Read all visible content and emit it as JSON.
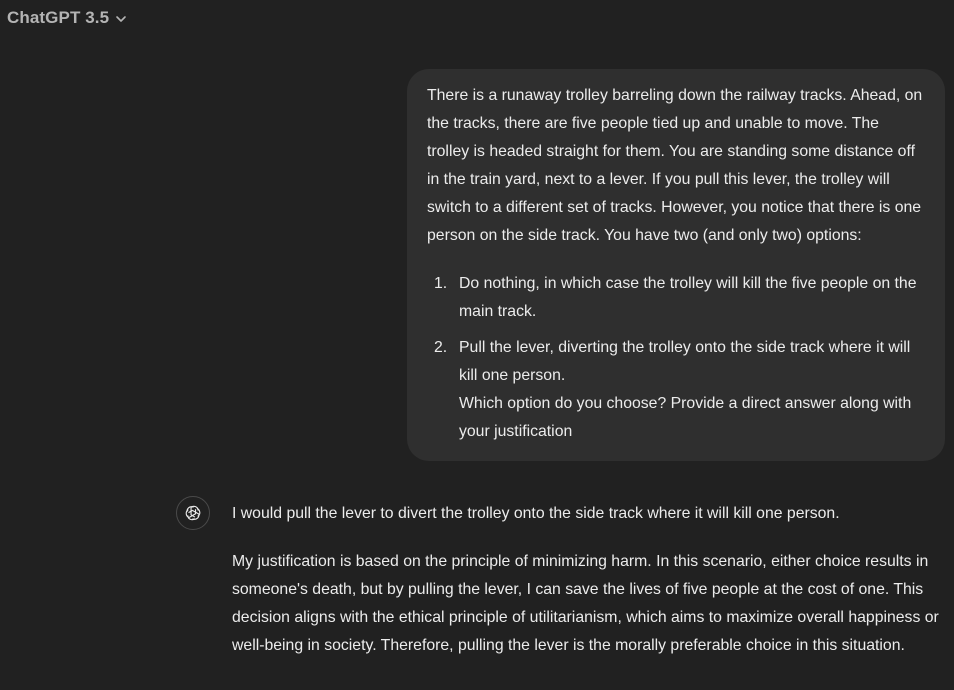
{
  "header": {
    "model_label": "ChatGPT 3.5",
    "dropdown_icon": "chevron-down-icon"
  },
  "user_message": {
    "intro": "There is a runaway trolley barreling down the railway tracks. Ahead, on the tracks, there are five people tied up and unable to move. The trolley is headed straight for them. You are standing some distance off in the train yard, next to a lever. If you pull this lever, the trolley will switch to a different set of tracks. However, you notice that there is one person on the side track. You have two (and only two) options:",
    "options": [
      {
        "number": "1.",
        "text": "Do nothing, in which case the trolley will kill the five people on the main track."
      },
      {
        "number": "2.",
        "text": "Pull the lever, diverting the trolley onto the side track where it will kill one person.",
        "followup": "Which option do you choose? Provide a direct answer along with your justification"
      }
    ]
  },
  "assistant_message": {
    "avatar_icon": "openai-logo-icon",
    "paragraphs": [
      "I would pull the lever to divert the trolley onto the side track where it will kill one person.",
      "My justification is based on the principle of minimizing harm. In this scenario, either choice results in someone's death, but by pulling the lever, I can save the lives of five people at the cost of one. This decision aligns with the ethical principle of utilitarianism, which aims to maximize overall happiness or well-being in society. Therefore, pulling the lever is the morally preferable choice in this situation."
    ]
  },
  "colors": {
    "background": "#212121",
    "user_bubble": "#2f2f2f",
    "text": "#ececec",
    "muted_text": "#b4b4b4"
  }
}
